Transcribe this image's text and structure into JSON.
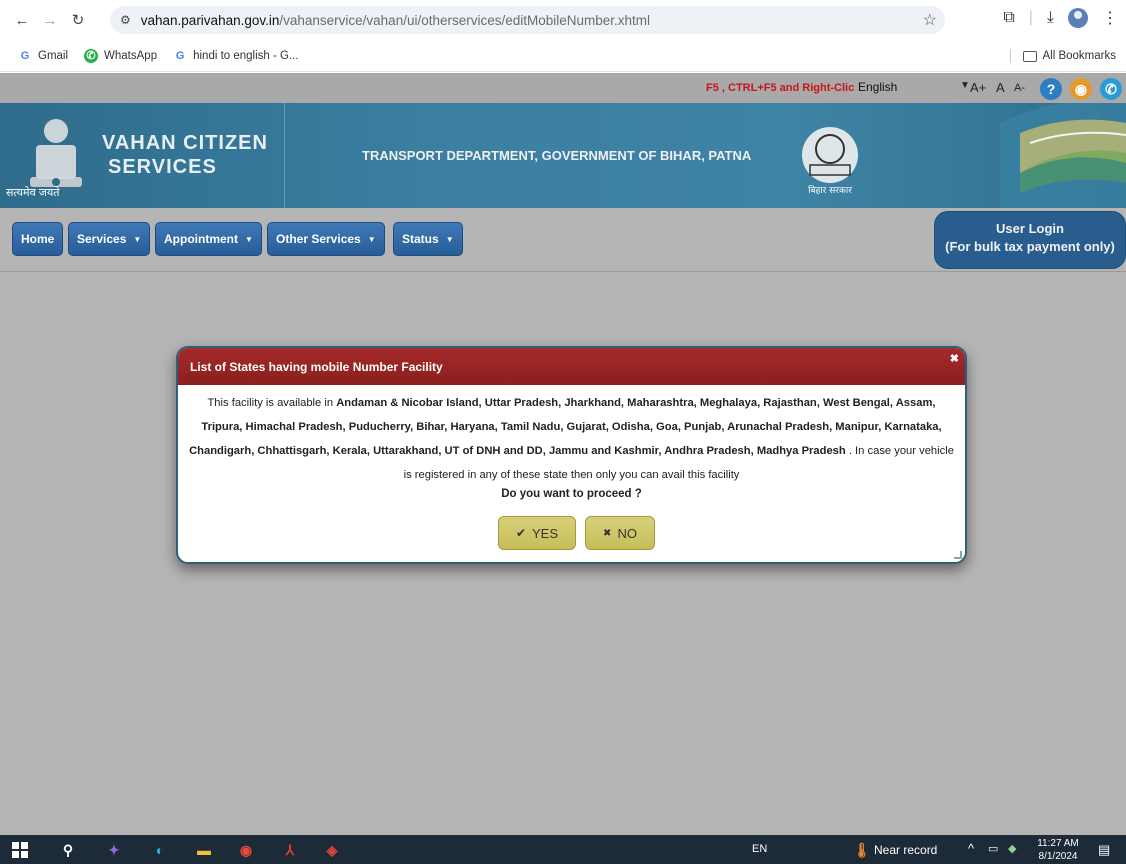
{
  "browser": {
    "url_host": "vahan.parivahan.gov.in",
    "url_path": "/vahanservice/vahan/ui/otherservices/editMobileNumber.xhtml",
    "bookmarks": [
      {
        "label": "Gmail",
        "icon": "google-icon"
      },
      {
        "label": "WhatsApp",
        "icon": "whatsapp-icon"
      },
      {
        "label": "hindi to english - G...",
        "icon": "google-icon"
      }
    ],
    "all_bookmarks": "All Bookmarks"
  },
  "topbar": {
    "notice": "F5 , CTRL+F5 and Right-Clic",
    "language": "English",
    "font_large": "A+",
    "font_normal": "A",
    "font_small": "A-"
  },
  "header": {
    "title_line1": "VAHAN CITIZEN",
    "title_line2": "SERVICES",
    "motto": "सत्यमेव जयते",
    "department": "TRANSPORT DEPARTMENT, GOVERNMENT OF BIHAR, PATNA",
    "seal_caption": "बिहार सरकार"
  },
  "menu": {
    "items": [
      "Home",
      "Services",
      "Appointment",
      "Other Services",
      "Status"
    ],
    "login_line1": "User Login",
    "login_line2": "(For bulk tax payment only)"
  },
  "dialog": {
    "title": "List of States having mobile Number Facility",
    "intro": "This facility is available in ",
    "states": "Andaman & Nicobar Island, Uttar Pradesh, Jharkhand, Maharashtra, Meghalaya, Rajasthan, West Bengal, Assam, Tripura, Himachal Pradesh, Puducherry, Bihar, Haryana, Tamil Nadu, Gujarat, Odisha, Goa, Punjab, Arunachal Pradesh, Manipur, Karnataka, Chandigarh, Chhattisgarh, Kerala, Uttarakhand, UT of DNH and DD, Jammu and Kashmir, Andhra Pradesh, Madhya Pradesh",
    "outro": " . In case your vehicle is registered in any of these state then only you can avail this facility",
    "question": "Do you want to proceed ?",
    "yes_label": "YES",
    "no_label": "NO"
  },
  "taskbar": {
    "language": "EN",
    "weather": "Near record",
    "time": "11:27 AM",
    "date": "8/1/2024"
  }
}
